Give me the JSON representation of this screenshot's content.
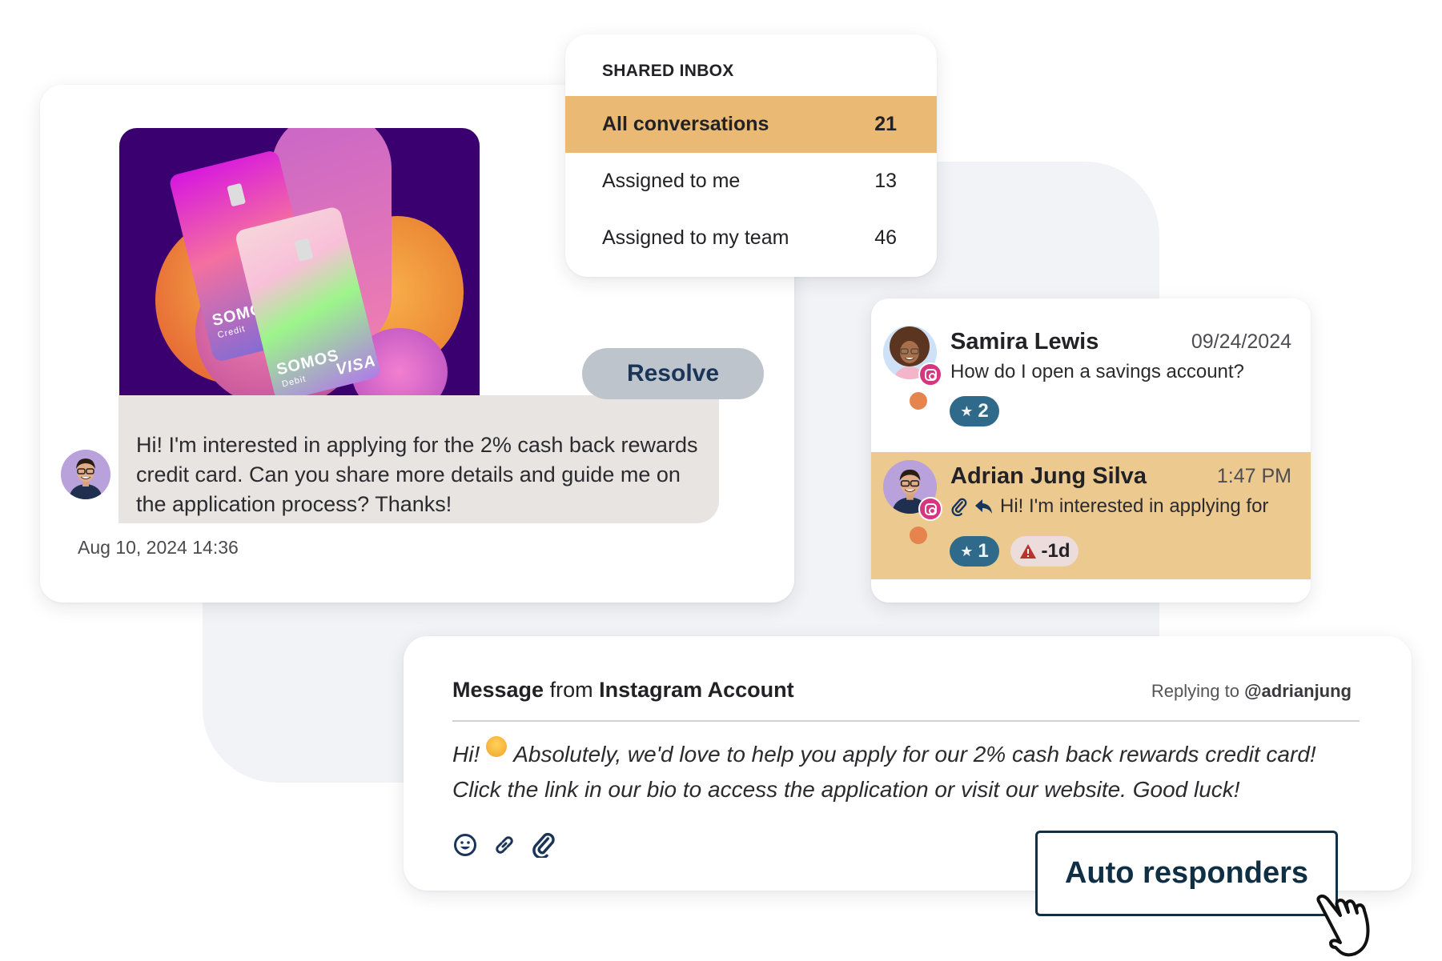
{
  "chat": {
    "promo_image": {
      "alt": "Somos credit and debit cards",
      "card1_brand": "SOMOS",
      "card1_type": "Credit",
      "card2_brand": "SOMOS",
      "card2_type": "Debit",
      "card2_network": "VISA",
      "background_color": "#3b0070"
    },
    "message": "Hi! I'm interested in applying for the 2% cash back rewards credit card. Can you share more details and guide me on the application process? Thanks!",
    "timestamp": "Aug 10, 2024 14:36",
    "resolve_label": "Resolve"
  },
  "inbox": {
    "title": "SHARED INBOX",
    "rows": [
      {
        "label": "All conversations",
        "count": "21",
        "active": true
      },
      {
        "label": "Assigned to me",
        "count": "13",
        "active": false
      },
      {
        "label": "Assigned to my team",
        "count": "46",
        "active": false
      }
    ],
    "active_color": "#eab973"
  },
  "conversations": [
    {
      "name": "Samira Lewis",
      "time": "09/24/2024",
      "preview": "How do I open a savings account?",
      "channel": "instagram-icon",
      "star_count": "2",
      "active": false
    },
    {
      "name": "Adrian Jung Silva",
      "time": "1:47 PM",
      "preview": "Hi! I'm interested in applying for",
      "channel": "instagram-icon",
      "preview_icons": [
        "paperclip-icon",
        "reply-icon"
      ],
      "star_count": "1",
      "sla_label": "-1d",
      "active": true
    }
  ],
  "compose": {
    "head_bold1": "Message",
    "head_mid": " from ",
    "head_bold2": "Instagram Account",
    "reply_prefix": "Replying to ",
    "reply_handle": "@adrianjung",
    "body_line1_a": "Hi!",
    "body_line1_b": "Absolutely, we'd love to help you apply for our 2% cash back rewards credit card!",
    "body_line2": "Click the link in our bio to access the application or visit our website. Good luck!",
    "tools": [
      "emoji-icon",
      "link-icon",
      "paperclip-icon"
    ]
  },
  "auto_responders_label": "Auto responders",
  "colors": {
    "accent_dark": "#123044",
    "star_pill": "#2f6a8b",
    "instagram": "#d6367f",
    "status_dot": "#e6844e",
    "warning": "#b8332d"
  }
}
